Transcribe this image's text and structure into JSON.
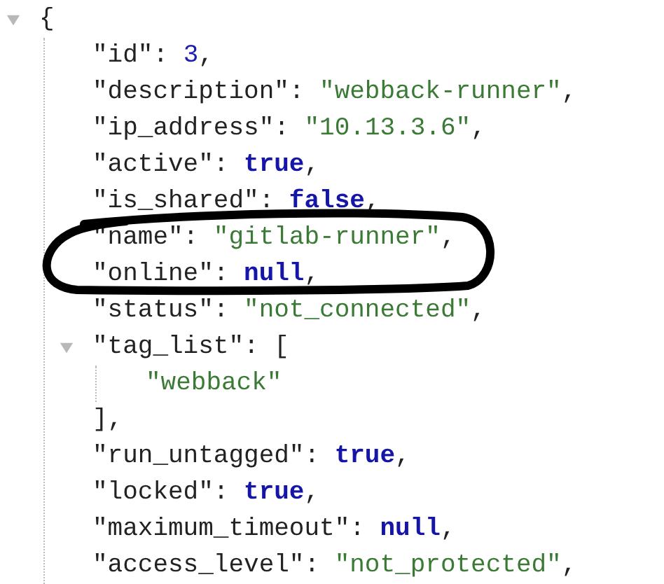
{
  "viewer": {
    "root": {
      "open": "{",
      "expanded": true,
      "children": [
        {
          "key": "\"id\":",
          "value": "3",
          "kind": "number",
          "suffix": ","
        },
        {
          "key": "\"description\":",
          "value": "\"webback-runner\"",
          "kind": "string",
          "suffix": ","
        },
        {
          "key": "\"ip_address\":",
          "value": "\"10.13.3.6\"",
          "kind": "string",
          "suffix": ","
        },
        {
          "key": "\"active\":",
          "value": "true",
          "kind": "boolean",
          "suffix": ","
        },
        {
          "key": "\"is_shared\":",
          "value": "false",
          "kind": "boolean",
          "suffix": ","
        },
        {
          "key": "\"name\":",
          "value": "\"gitlab-runner\"",
          "kind": "string",
          "suffix": ","
        },
        {
          "key": "\"online\":",
          "value": "null",
          "kind": "null",
          "suffix": ","
        },
        {
          "key": "\"status\":",
          "value": "\"not_connected\"",
          "kind": "string",
          "suffix": ","
        },
        {
          "key": "\"tag_list\":",
          "open": "[",
          "expanded": true,
          "close": "],",
          "children": [
            {
              "value": "\"webback\"",
              "kind": "string"
            }
          ]
        },
        {
          "key": "\"run_untagged\":",
          "value": "true",
          "kind": "boolean",
          "suffix": ","
        },
        {
          "key": "\"locked\":",
          "value": "true",
          "kind": "boolean",
          "suffix": ","
        },
        {
          "key": "\"maximum_timeout\":",
          "value": "null",
          "kind": "null",
          "suffix": ","
        },
        {
          "key": "\"access_level\":",
          "value": "\"not_protected\"",
          "kind": "string",
          "suffix": ","
        }
      ]
    }
  },
  "annotation": {
    "kind": "ellipse"
  }
}
